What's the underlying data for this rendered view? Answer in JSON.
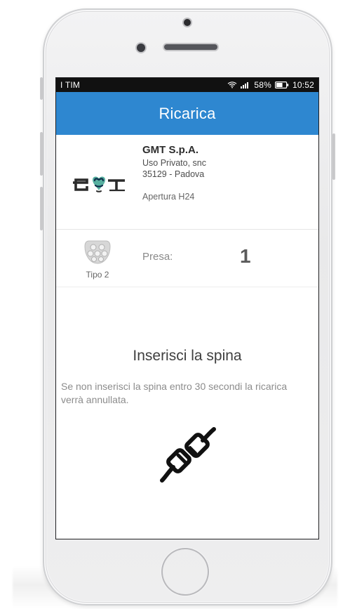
{
  "status_bar": {
    "carrier": "I TIM",
    "battery_percent": "58%",
    "time": "10:52"
  },
  "app_bar": {
    "title": "Ricarica",
    "color": "#2e87d0"
  },
  "station": {
    "name": "GMT S.p.A.",
    "address_line1": "Uso Privato, snc",
    "address_line2": "35129 - Padova",
    "hours": "Apertura H24",
    "logo_icon": "gmt-logo"
  },
  "socket": {
    "type": "Tipo 2",
    "label": "Presa:",
    "number": "1",
    "icon": "type2-socket-icon"
  },
  "instruction": {
    "title": "Inserisci la spina",
    "text": "Se non inserisci la spina entro 30 secondi la ricarica verrà annullata.",
    "icon": "plug-icon"
  },
  "device": {
    "home_button_icon": "home-button"
  }
}
